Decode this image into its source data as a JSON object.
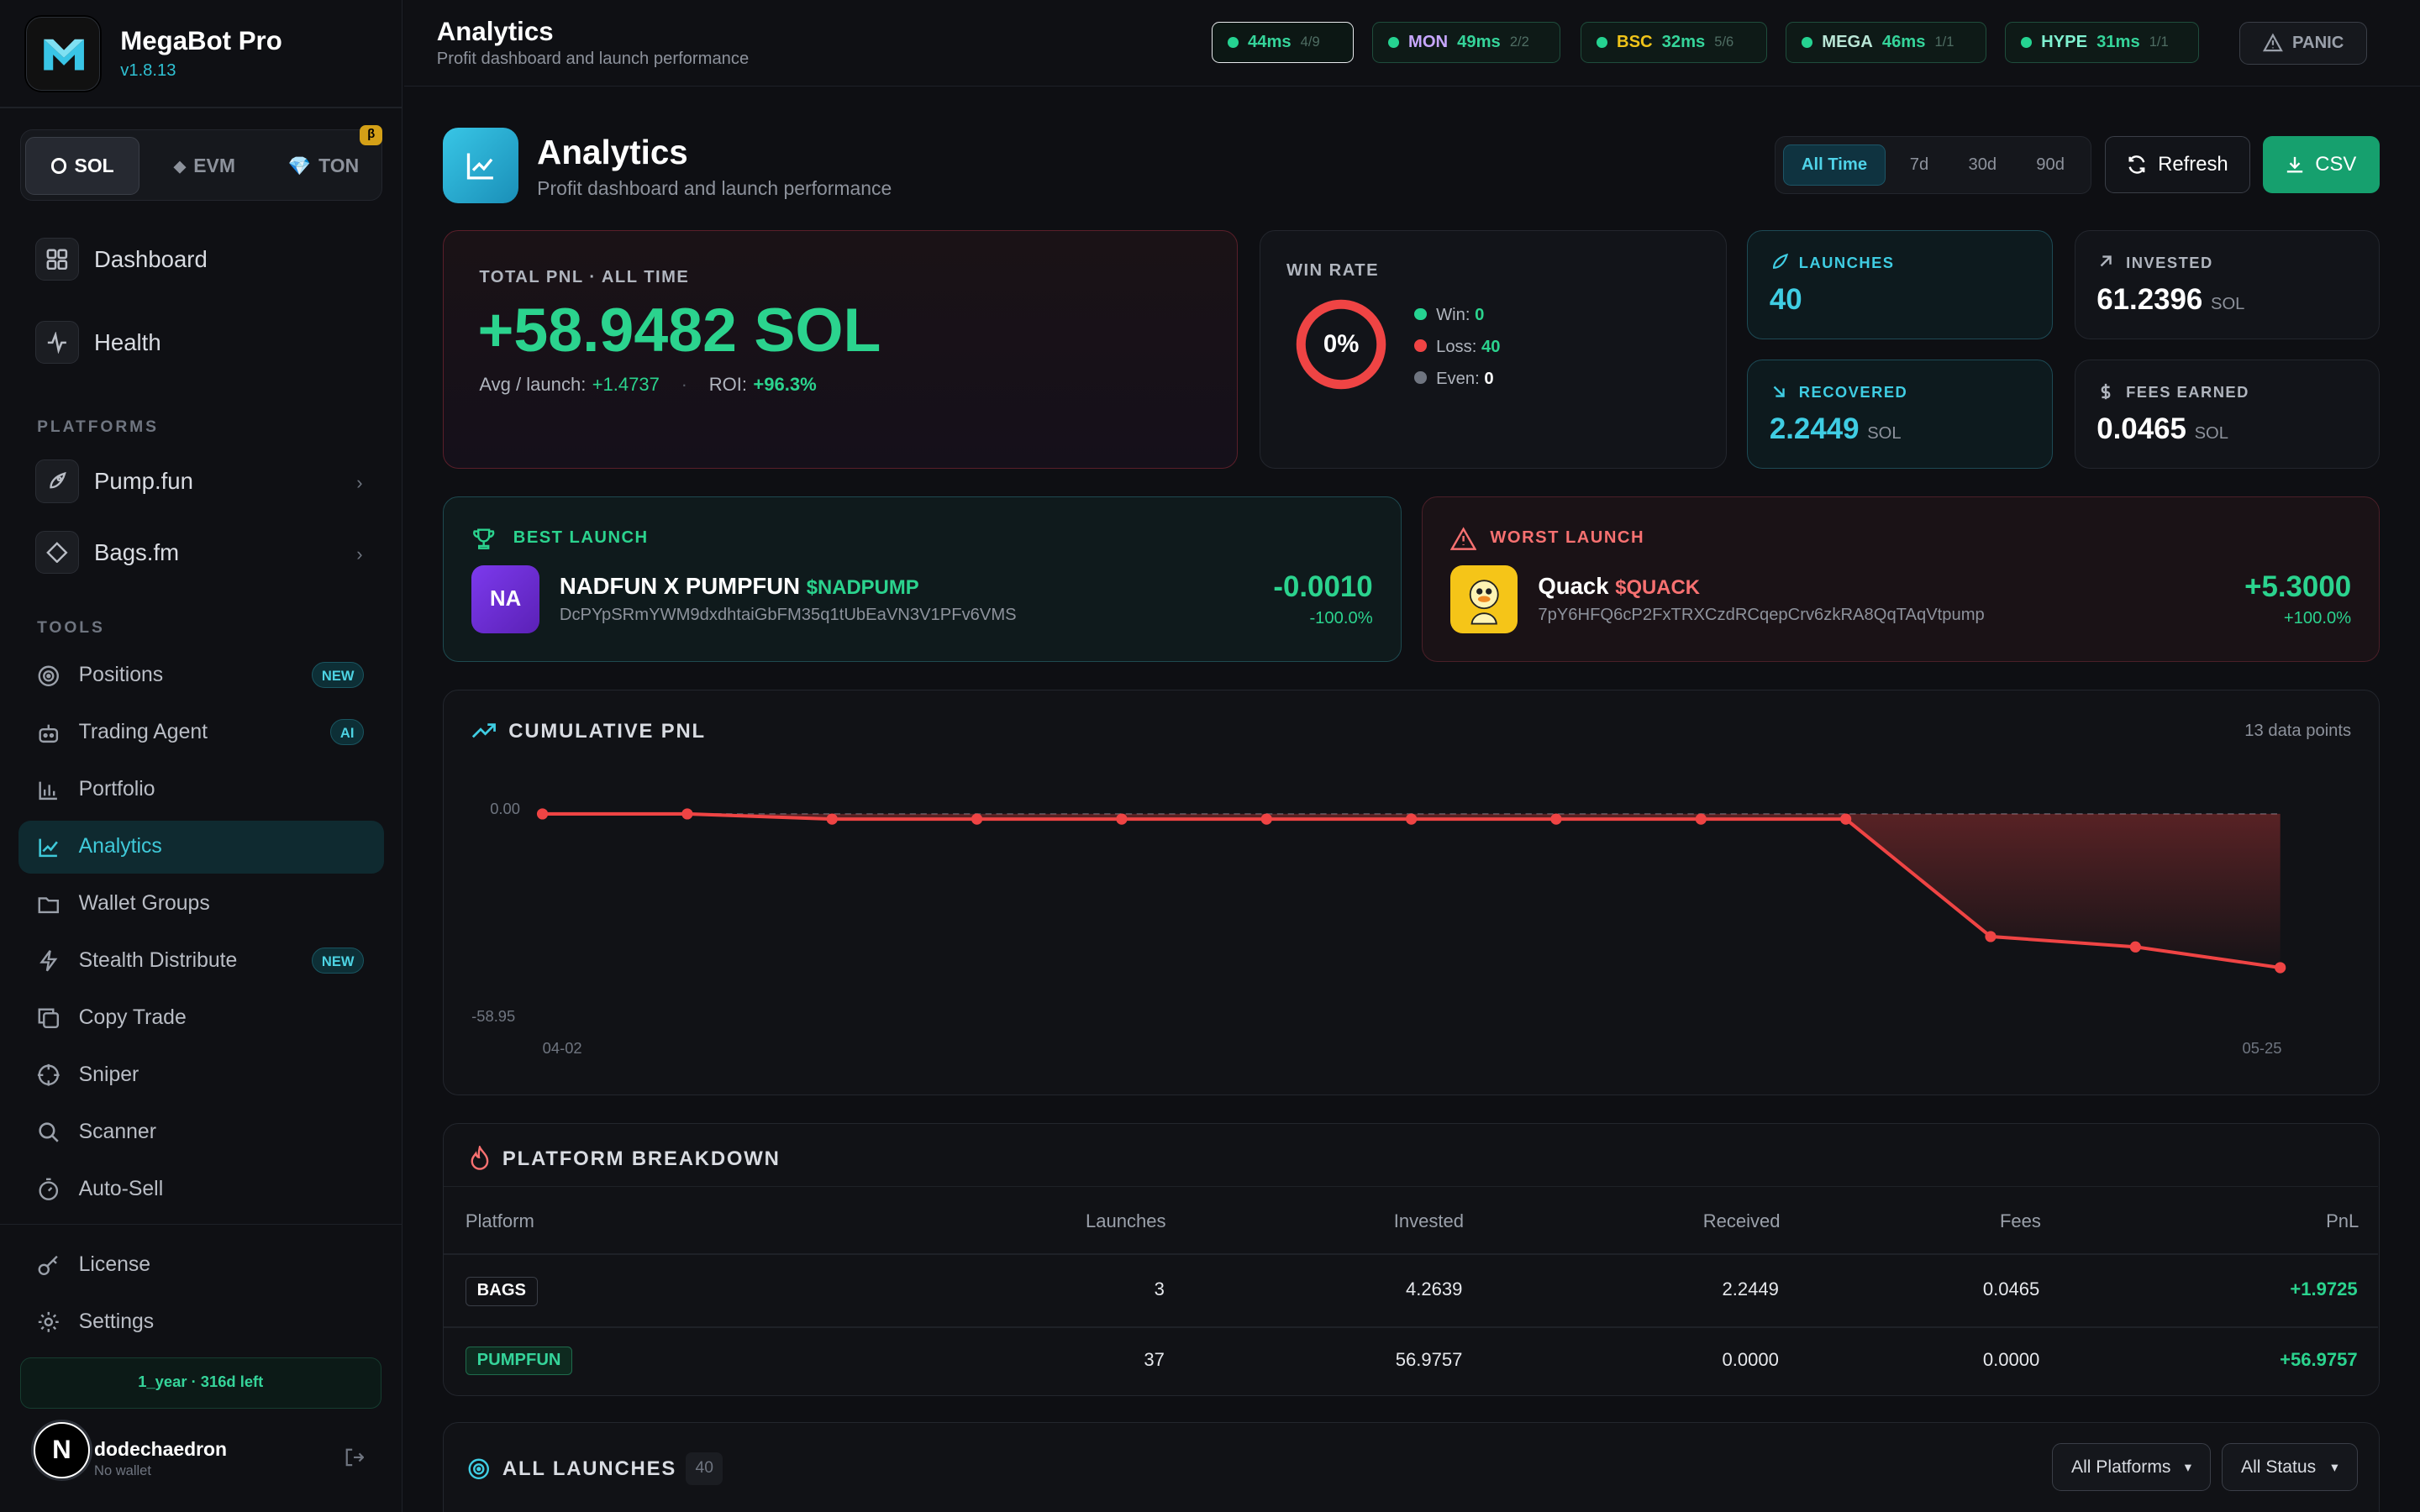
{
  "app": {
    "name": "MegaBot Pro",
    "version": "v1.8.13"
  },
  "chains": [
    {
      "label": "SOL"
    },
    {
      "label": "EVM"
    },
    {
      "label": "TON"
    }
  ],
  "chain_beta": "β",
  "nav_main": [
    {
      "label": "Dashboard"
    },
    {
      "label": "Health"
    }
  ],
  "platforms_label": "PLATFORMS",
  "platforms": [
    {
      "label": "Pump.fun"
    },
    {
      "label": "Bags.fm"
    }
  ],
  "tools_label": "TOOLS",
  "tools": [
    {
      "label": "Positions",
      "badge": "NEW"
    },
    {
      "label": "Trading Agent",
      "badge": "AI"
    },
    {
      "label": "Portfolio"
    },
    {
      "label": "Analytics"
    },
    {
      "label": "Wallet Groups"
    },
    {
      "label": "Stealth Distribute",
      "badge": "NEW"
    },
    {
      "label": "Copy Trade"
    },
    {
      "label": "Sniper"
    },
    {
      "label": "Scanner"
    },
    {
      "label": "Auto-Sell"
    }
  ],
  "bottom_nav": [
    {
      "label": "License"
    },
    {
      "label": "Settings"
    }
  ],
  "license_status": "1_year · 316d left",
  "user": {
    "name": "dodechaedron",
    "wallet": "No wallet",
    "initial": "N"
  },
  "header": {
    "title": "Analytics",
    "subtitle": "Profit dashboard and launch performance"
  },
  "rpc": [
    {
      "chain": "",
      "ms": "44ms",
      "count": "4/9",
      "color": "#35d49a"
    },
    {
      "chain": "MON",
      "ms": "49ms",
      "count": "2/2",
      "color": "#c7a7ff"
    },
    {
      "chain": "BSC",
      "ms": "32ms",
      "count": "5/6",
      "color": "#f0c419"
    },
    {
      "chain": "MEGA",
      "ms": "46ms",
      "count": "1/1",
      "color": "#b9e6d6"
    },
    {
      "chain": "HYPE",
      "ms": "31ms",
      "count": "1/1",
      "color": "#7ff0d0"
    }
  ],
  "panic": "PANIC",
  "page": {
    "title": "Analytics",
    "subtitle": "Profit dashboard and launch performance"
  },
  "ranges": [
    "All Time",
    "7d",
    "30d",
    "90d"
  ],
  "refresh": "Refresh",
  "csv": "CSV",
  "total_pnl": {
    "label": "TOTAL PNL · ALL TIME",
    "value": "+58.9482 SOL",
    "avg_label": "Avg / launch:",
    "avg": "+1.4737",
    "roi_label": "ROI:",
    "roi": "+96.3%"
  },
  "win_rate": {
    "label": "WIN RATE",
    "pct": "0%",
    "win_label": "Win:",
    "win": "0",
    "loss_label": "Loss:",
    "loss": "40",
    "even_label": "Even:",
    "even": "0"
  },
  "stats": {
    "launches": {
      "label": "LAUNCHES",
      "value": "40"
    },
    "invested": {
      "label": "INVESTED",
      "value": "61.2396",
      "unit": "SOL"
    },
    "recovered": {
      "label": "RECOVERED",
      "value": "2.2449",
      "unit": "SOL"
    },
    "fees": {
      "label": "FEES EARNED",
      "value": "0.0465",
      "unit": "SOL"
    }
  },
  "best": {
    "label": "BEST LAUNCH",
    "initials": "NA",
    "name": "NADFUN X PUMPFUN",
    "ticker": "$NADPUMP",
    "address": "DcPYpSRmYWM9dxdhtaiGbFM35q1tUbEaVN3V1PFv6VMS",
    "value": "-0.0010",
    "pct": "-100.0%"
  },
  "worst": {
    "label": "WORST LAUNCH",
    "name": "Quack",
    "ticker": "$QUACK",
    "address": "7pY6HFQ6cP2FxTRXCzdRCqepCrv6zkRA8QqTAqVtpump",
    "value": "+5.3000",
    "pct": "+100.0%"
  },
  "chart": {
    "title": "CUMULATIVE PNL",
    "points_label": "13 data points",
    "y_top": "0.00",
    "y_bottom": "-58.95",
    "x_start": "04-02",
    "x_end": "05-25"
  },
  "chart_data": {
    "type": "area",
    "title": "CUMULATIVE PNL",
    "x": [
      "04-02",
      "",
      "",
      "",
      "",
      "",
      "",
      "",
      "",
      "",
      "",
      "",
      "05-25"
    ],
    "values": [
      0,
      0,
      -1.5,
      -1.5,
      -1.5,
      -1.5,
      -1.5,
      -1.5,
      -1.5,
      -1.5,
      -35.5,
      -38.5,
      -44.5
    ],
    "ylim": [
      -58.95,
      0.0
    ]
  },
  "breakdown": {
    "title": "PLATFORM BREAKDOWN",
    "headers": [
      "Platform",
      "Launches",
      "Invested",
      "Received",
      "Fees",
      "PnL"
    ],
    "rows": [
      {
        "platform": "BAGS",
        "launches": "3",
        "invested": "4.2639",
        "received": "2.2449",
        "fees": "0.0465",
        "pnl": "+1.9725"
      },
      {
        "platform": "PUMPFUN",
        "launches": "37",
        "invested": "56.9757",
        "received": "0.0000",
        "fees": "0.0000",
        "pnl": "+56.9757"
      }
    ]
  },
  "all_launches": {
    "title": "ALL LAUNCHES",
    "count": "40",
    "filter_platform": "All Platforms",
    "filter_status": "All Status"
  }
}
